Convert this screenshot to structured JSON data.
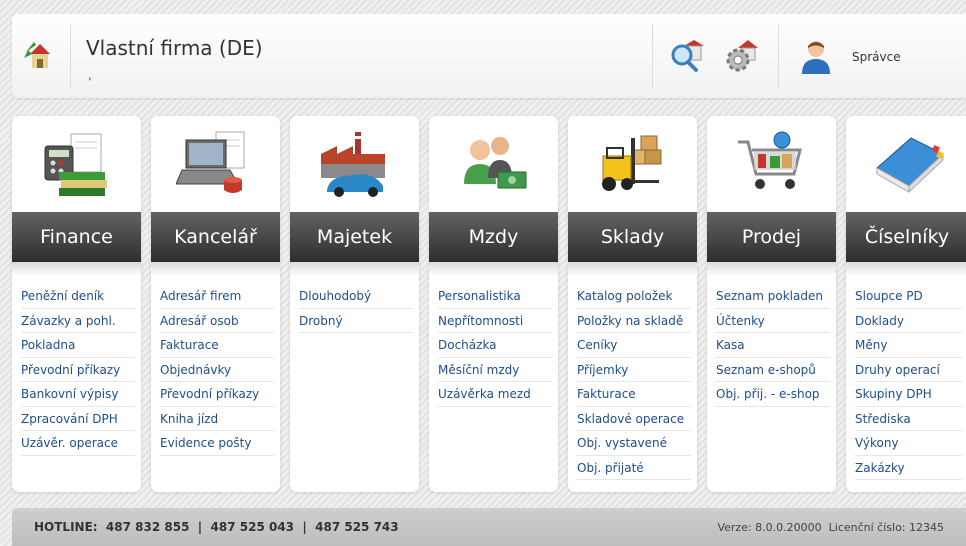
{
  "header": {
    "company_title": "Vlastní firma (DE)",
    "company_sub": ",",
    "user_name": "Správce"
  },
  "modules": [
    {
      "title": "Finance",
      "icon": "calculator-books-icon",
      "links": [
        "Peněžní deník",
        "Závazky a pohl.",
        "Pokladna",
        "Převodní příkazy",
        "Bankovní výpisy",
        "Zpracování DPH",
        "Uzávěr. operace"
      ]
    },
    {
      "title": "Kancelář",
      "icon": "laptop-icon",
      "links": [
        "Adresář firem",
        "Adresář osob",
        "Fakturace",
        "Objednávky",
        "Převodní příkazy",
        "Kniha jízd",
        "Evidence pošty"
      ]
    },
    {
      "title": "Majetek",
      "icon": "factory-car-icon",
      "links": [
        "Dlouhodobý",
        "Drobný"
      ]
    },
    {
      "title": "Mzdy",
      "icon": "people-money-icon",
      "links": [
        "Personalistika",
        "Nepřítomnosti",
        "Docházka",
        "Měsíční mzdy",
        "Uzávěrka mezd"
      ]
    },
    {
      "title": "Sklady",
      "icon": "forklift-icon",
      "links": [
        "Katalog položek",
        "Položky na skladě",
        "Ceníky",
        "Příjemky",
        "Fakturace",
        "Skladové operace",
        "Obj. vystavené",
        "Obj. přijaté"
      ]
    },
    {
      "title": "Prodej",
      "icon": "shopping-cart-icon",
      "links": [
        "Seznam pokladen",
        "Účtenky",
        "Kasa",
        "Seznam e-shopů",
        "Obj. přij. - e-shop"
      ]
    },
    {
      "title": "Číselníky",
      "icon": "book-icon",
      "links": [
        "Sloupce PD",
        "Doklady",
        "Měny",
        "Druhy operací",
        "Skupiny DPH",
        "Střediska",
        "Výkony",
        "Zakázky"
      ]
    }
  ],
  "footer": {
    "hotline": "HOTLINE:  487 832 855  |  487 525 043  |  487 525 743",
    "version": "Verze: 8.0.0.20000  Licenční číslo: 12345"
  },
  "colors": {
    "link": "#1f4e8c",
    "module_header": "#3a3a3a",
    "footer": "#c8c8c8"
  }
}
